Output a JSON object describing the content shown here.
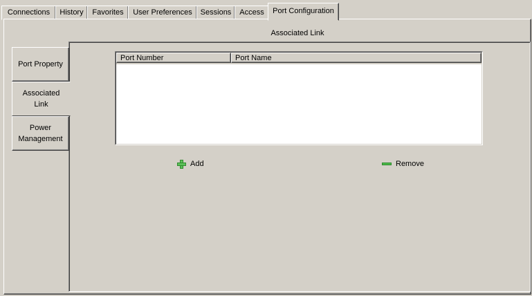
{
  "tabs": [
    {
      "label": "Connections",
      "active": false
    },
    {
      "label": "History",
      "active": false
    },
    {
      "label": "Favorites",
      "active": false
    },
    {
      "label": "User Preferences",
      "active": false
    },
    {
      "label": "Sessions",
      "active": false
    },
    {
      "label": "Access",
      "active": false
    },
    {
      "label": "Port Configuration",
      "active": true
    }
  ],
  "panel_title": "Associated Link",
  "side_tabs": [
    {
      "label": "Port Property",
      "active": false
    },
    {
      "label": "Associated Link",
      "active": true
    },
    {
      "label": "Power Management",
      "active": false
    }
  ],
  "table": {
    "columns": [
      "Port Number",
      "Port Name"
    ],
    "rows": []
  },
  "buttons": {
    "add_label": "Add",
    "remove_label": "Remove"
  },
  "colors": {
    "background": "#d4d0c8",
    "list_background": "#ffffff",
    "icon_green": "#5cc05a"
  },
  "icons": {
    "add": "plus-icon",
    "remove": "minus-icon"
  }
}
